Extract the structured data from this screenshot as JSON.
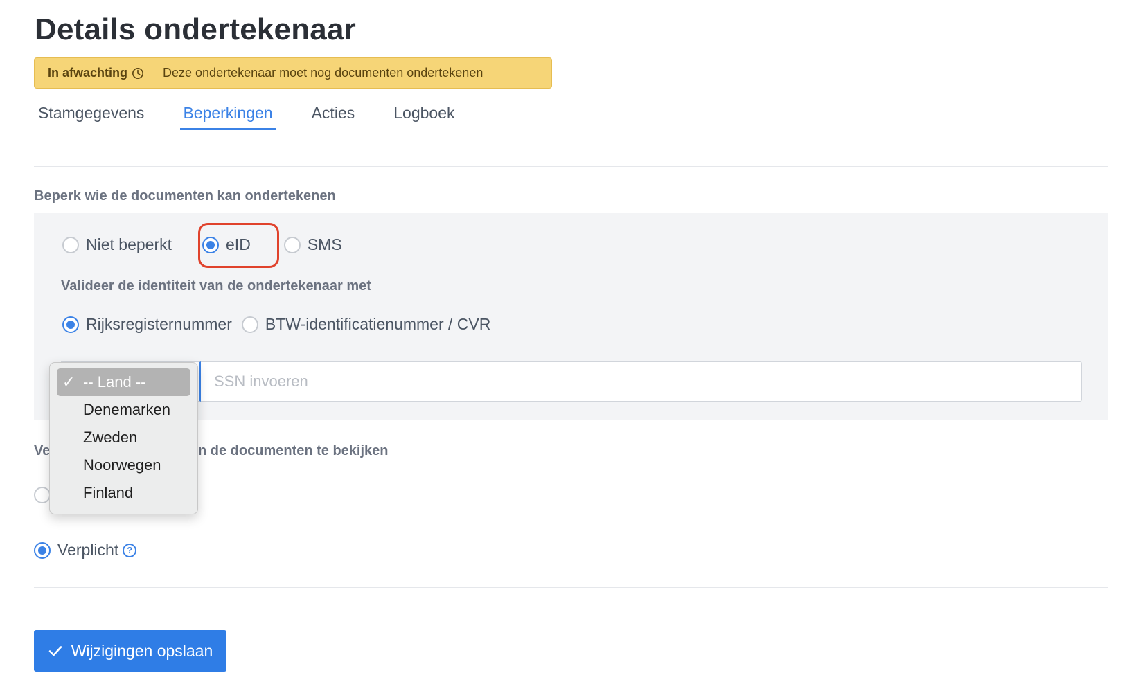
{
  "header": {
    "title": "Details ondertekenaar",
    "status_label": "In afwachting",
    "status_message": "Deze ondertekenaar moet nog documenten ondertekenen",
    "status_icon": "clock-icon"
  },
  "tabs": [
    {
      "label": "Stamgegevens",
      "active": false
    },
    {
      "label": "Beperkingen",
      "active": true
    },
    {
      "label": "Acties",
      "active": false
    },
    {
      "label": "Logboek",
      "active": false
    }
  ],
  "restrict": {
    "heading": "Beperk wie de documenten kan ondertekenen",
    "options": [
      {
        "label": "Niet beperkt",
        "checked": false
      },
      {
        "label": "eID",
        "checked": true
      },
      {
        "label": "SMS",
        "checked": false
      }
    ],
    "validate_heading": "Valideer de identiteit van de ondertekenaar met",
    "validate_options": [
      {
        "label": "Rijksregisternummer",
        "checked": true
      },
      {
        "label": "BTW-identificatienummer / CVR",
        "checked": false
      }
    ],
    "ssn_placeholder": "SSN invoeren",
    "country_dropdown": {
      "options": [
        "-- Land --",
        "Denemarken",
        "Zweden",
        "Noorwegen",
        "Finland"
      ],
      "selected": "-- Land --"
    }
  },
  "view": {
    "heading_prefix": "Ve",
    "heading_suffix": "n de documenten te bekijken",
    "required_label": "Verplicht",
    "required_checked": true
  },
  "actions": {
    "save_label": "Wijzigingen opslaan"
  },
  "colors": {
    "accent": "#3b82e6",
    "banner": "#f6d577",
    "highlight": "#e0422c"
  }
}
